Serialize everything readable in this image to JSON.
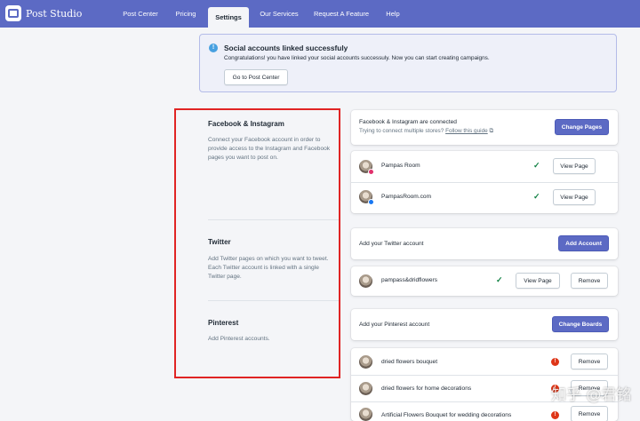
{
  "app": {
    "brand": "Post Studio"
  },
  "nav": [
    {
      "label": "Post Center",
      "active": false
    },
    {
      "label": "Pricing",
      "active": false
    },
    {
      "label": "Settings",
      "active": true
    },
    {
      "label": "Our Services",
      "active": false
    },
    {
      "label": "Request A Feature",
      "active": false
    },
    {
      "label": "Help",
      "active": false
    }
  ],
  "banner": {
    "title": "Social accounts linked successfuly",
    "text": "Congratulations! you have linked your social accounts successuly. Now you can start creating campaigns.",
    "button": "Go to Post Center"
  },
  "sections": {
    "facebook": {
      "title": "Facebook & Instagram",
      "description": "Connect your Facebook account in order to provide access to the Instagram and Facebook pages you want to post on.",
      "status": "Facebook & Instagram are connected",
      "help_prefix": "Trying to connect multiple stores?",
      "help_link": "Follow this guide",
      "action": "Change Pages",
      "accounts": [
        {
          "name": "Pampas Room",
          "status": "connected",
          "action": "View Page",
          "badge_color": "#e1306c"
        },
        {
          "name": "PampasRoom.com",
          "status": "connected",
          "action": "View Page",
          "badge_color": "#1877f2"
        }
      ]
    },
    "twitter": {
      "title": "Twitter",
      "description": "Add Twitter pages on which you want to tweet. Each Twitter account is linked with a single Twitter page.",
      "status": "Add your Twitter account",
      "action": "Add Account",
      "accounts": [
        {
          "name": "pampass&dridflowers",
          "status": "connected",
          "action": "View Page",
          "remove": "Remove"
        }
      ]
    },
    "pinterest": {
      "title": "Pinterest",
      "description": "Add Pinterest accounts.",
      "status": "Add your Pinterest account",
      "action": "Change Boards",
      "boards": [
        {
          "name": "dried flowers bouquet",
          "status": "warning",
          "remove": "Remove"
        },
        {
          "name": "dried flowers for home decorations",
          "status": "warning",
          "remove": "Remove"
        },
        {
          "name": "Artificial Flowers Bouquet for wedding decorations",
          "status": "warning",
          "remove": "Remove"
        }
      ]
    }
  },
  "icons": {
    "info": "!",
    "check": "✓",
    "warning": "!",
    "external": "⧉"
  },
  "colors": {
    "accent": "#5c6ac4",
    "success": "#108043",
    "critical": "#de3618",
    "highlight": "#e02424"
  },
  "watermark": "知乎 @君铭"
}
